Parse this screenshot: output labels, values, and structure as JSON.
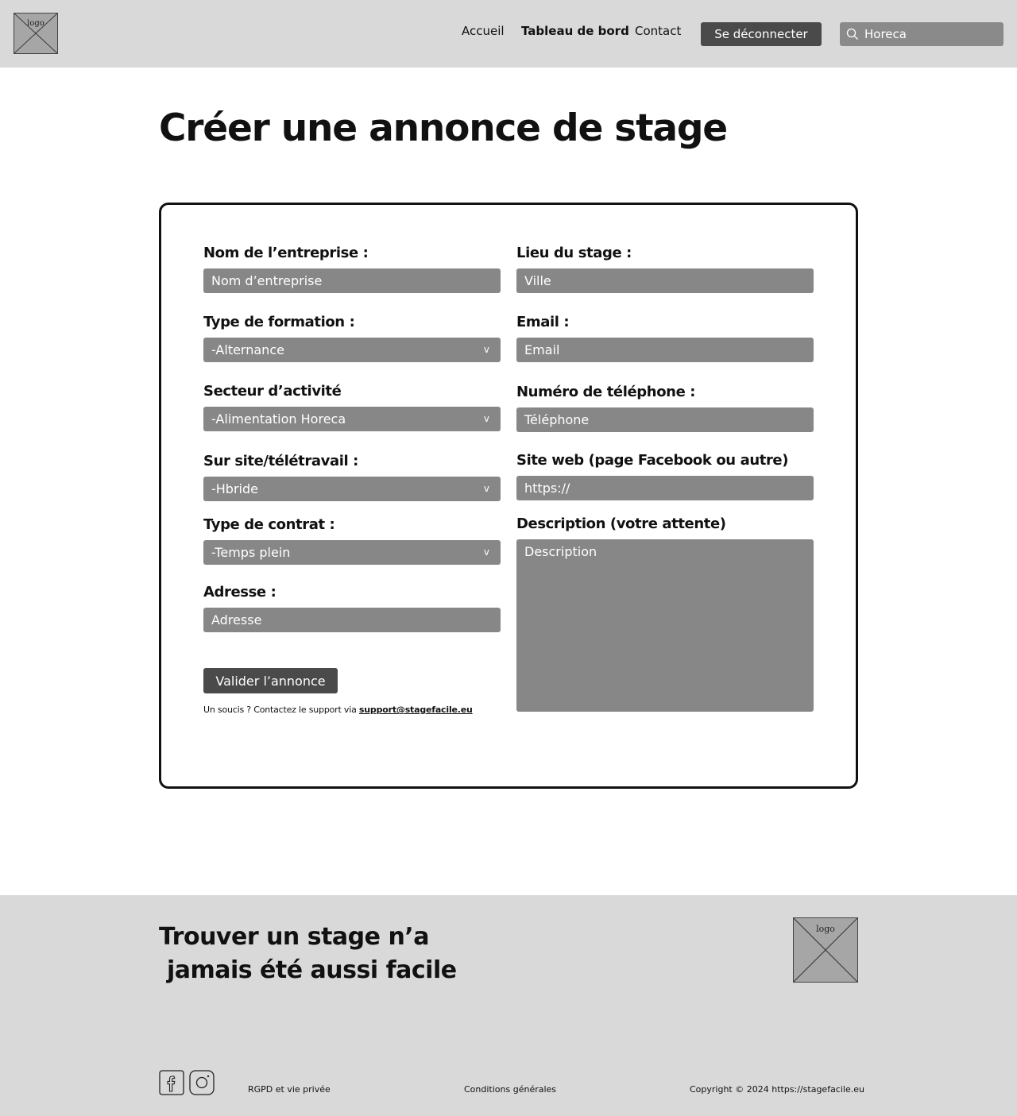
{
  "header": {
    "logo_text": "logo",
    "nav": [
      "Accueil",
      "Tableau de bord",
      "Contact"
    ],
    "logout_label": "Se déconnecter",
    "search_value": "Horeca"
  },
  "page_title": "Créer une annonce de stage",
  "form": {
    "company": {
      "label": "Nom de l’entreprise :",
      "placeholder": "Nom d’entreprise"
    },
    "location": {
      "label": "Lieu du stage :",
      "placeholder": "Ville"
    },
    "training_type": {
      "label": "Type de formation :",
      "value": "-Alternance"
    },
    "email": {
      "label": "Email :",
      "placeholder": "Email"
    },
    "sector": {
      "label": "Secteur d’activité",
      "value": "-Alimentation Horeca"
    },
    "phone": {
      "label": "Numéro de téléphone :",
      "placeholder": "Téléphone"
    },
    "work_mode": {
      "label": "Sur site/télétravail :",
      "value": "-Hbride"
    },
    "website": {
      "label": "Site web (page Facebook ou autre)",
      "placeholder": "https://"
    },
    "contract_type": {
      "label": "Type de contrat :",
      "value": "-Temps plein"
    },
    "description": {
      "label": "Description (votre attente)",
      "placeholder": "Description"
    },
    "address": {
      "label": "Adresse :",
      "placeholder": "Adresse"
    },
    "chevron": "v",
    "submit_label": "Valider l’annonce",
    "support_text": "Un soucis ? Contactez le support via ",
    "support_email": "support@stagefacile.eu"
  },
  "footer": {
    "tagline_line1": "Trouver un stage n’a",
    "tagline_line2": " jamais été aussi facile",
    "logo_text": "logo",
    "links": {
      "rgpd": "RGPD et vie privée",
      "terms": "Conditions générales",
      "copyright": "Copyright © 2024 https://stagefacile.eu"
    }
  },
  "icons": [
    "search-icon",
    "facebook-icon",
    "instagram-icon",
    "logo-placeholder"
  ],
  "colors": {
    "header_bg": "#d9d9d9",
    "button_dark": "#4a4a4a",
    "input_bg": "#878787",
    "search_bg": "#8a8a8a"
  }
}
